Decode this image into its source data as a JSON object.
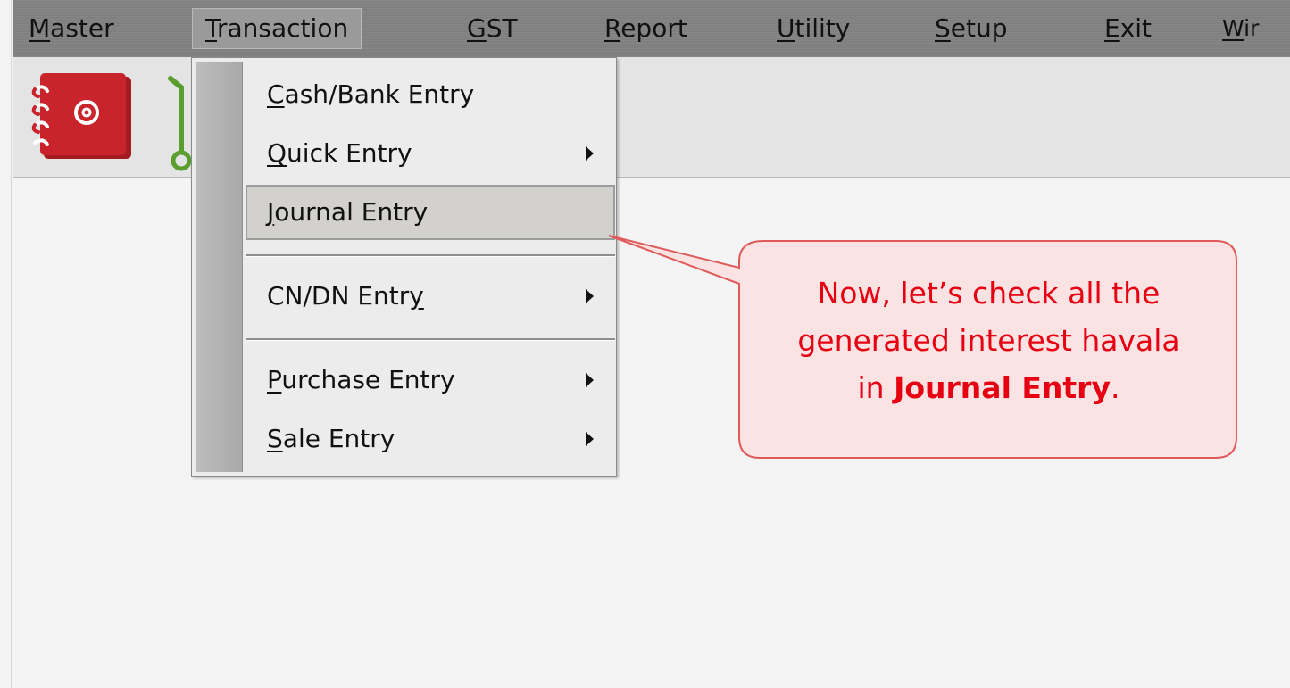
{
  "menubar": {
    "items": [
      {
        "label": "Master",
        "accel": "M"
      },
      {
        "label": "Transaction",
        "accel": "T"
      },
      {
        "label": "GST",
        "accel": "G"
      },
      {
        "label": "Report",
        "accel": "R"
      },
      {
        "label": "Utility",
        "accel": "U"
      },
      {
        "label": "Setup",
        "accel": "S"
      },
      {
        "label": "Exit",
        "accel": "E"
      },
      {
        "label": "Wir",
        "accel": "W"
      }
    ]
  },
  "toolbar": {
    "icons": [
      "address-book-icon",
      "green-hook-icon"
    ]
  },
  "dropdown": {
    "items": [
      {
        "pre": "",
        "accel": "C",
        "post": "ash/Bank Entry",
        "submenu": false
      },
      {
        "pre": "",
        "accel": "Q",
        "post": "uick Entry",
        "submenu": true
      },
      {
        "pre": "",
        "accel": "J",
        "post": "ournal Entry",
        "submenu": false,
        "highlighted": true
      },
      {
        "pre": "CN/DN Entr",
        "accel": "y",
        "post": "",
        "submenu": true
      },
      {
        "pre": "",
        "accel": "P",
        "post": "urchase Entry",
        "submenu": true
      },
      {
        "pre": "",
        "accel": "S",
        "post": "ale Entry",
        "submenu": true
      }
    ]
  },
  "callout": {
    "line1": "Now, let’s check all the",
    "line2": "generated interest havala",
    "line3_pre": "in ",
    "line3_bold": "Journal Entry",
    "line3_post": "."
  },
  "colors": {
    "menubar_bg": "#808080",
    "callout_fill": "#fbe3e3",
    "callout_stroke": "#e05a5a",
    "callout_text": "#e60012",
    "address_book_red": "#c9242b",
    "hook_green": "#5a9e2f"
  }
}
